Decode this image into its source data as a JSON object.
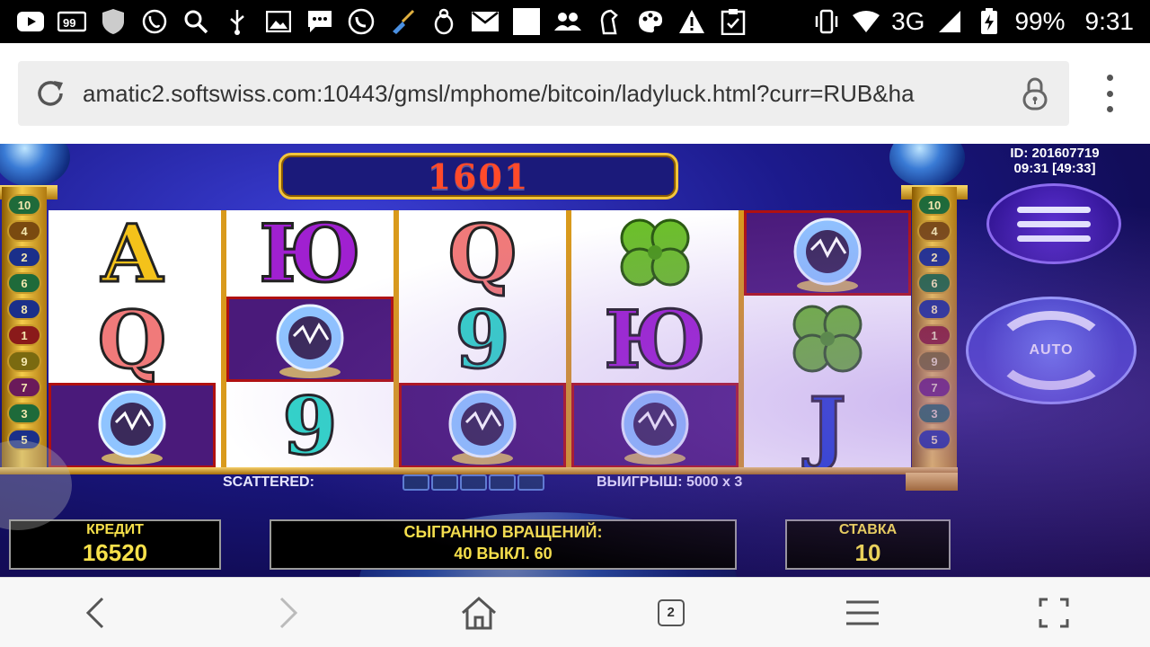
{
  "status_bar": {
    "network": "3G",
    "battery": "99%",
    "time": "9:31",
    "left_icons": [
      "youtube-icon",
      "news-icon",
      "shield-icon",
      "viber-icon",
      "search-icon",
      "usb-icon",
      "image-icon",
      "message-icon",
      "phone-icon",
      "broom-icon",
      "bug-icon",
      "mail-icon",
      "blank-icon",
      "people-icon",
      "horse-icon",
      "palette-icon",
      "warning-icon",
      "clipboard-icon"
    ]
  },
  "browser": {
    "url": "amatic2.softswiss.com:10443/gmsl/mphome/bitcoin/ladyluck.html?curr=RUB&ha",
    "tab_count": "2"
  },
  "game": {
    "win_amount": "1601",
    "id_line": "ID: 201607719",
    "time_line": "09:31 [49:33]",
    "line_numbers_left": [
      "10",
      "4",
      "2",
      "6",
      "8",
      "1",
      "9",
      "7",
      "3",
      "5"
    ],
    "line_numbers_right": [
      "10",
      "4",
      "2",
      "6",
      "8",
      "1",
      "9",
      "7",
      "3",
      "5"
    ],
    "reels": [
      [
        "A",
        "Q",
        "ball"
      ],
      [
        "Ю",
        "ball",
        "9"
      ],
      [
        "Q",
        "9",
        "ball"
      ],
      [
        "clover",
        "Ю",
        "ball"
      ],
      [
        "ball",
        "clover",
        "J"
      ]
    ],
    "scattered_label": "SCATTERED:",
    "win_info": "ВЫИГРЫШ: 5000 x 3",
    "credit_label": "КРЕДИТ",
    "credit_value": "16520",
    "spins_label": "СЫГРАННО ВРАЩЕНИЙ:",
    "spins_value": "40 ВЫКЛ. 60",
    "bet_label": "СТАВКА",
    "bet_value": "10",
    "auto_label": "AUTO"
  },
  "colors": {
    "reel_divider": "#d99a1c",
    "banner_text": "#ff4a2a",
    "panel_text": "#f6e04a"
  }
}
